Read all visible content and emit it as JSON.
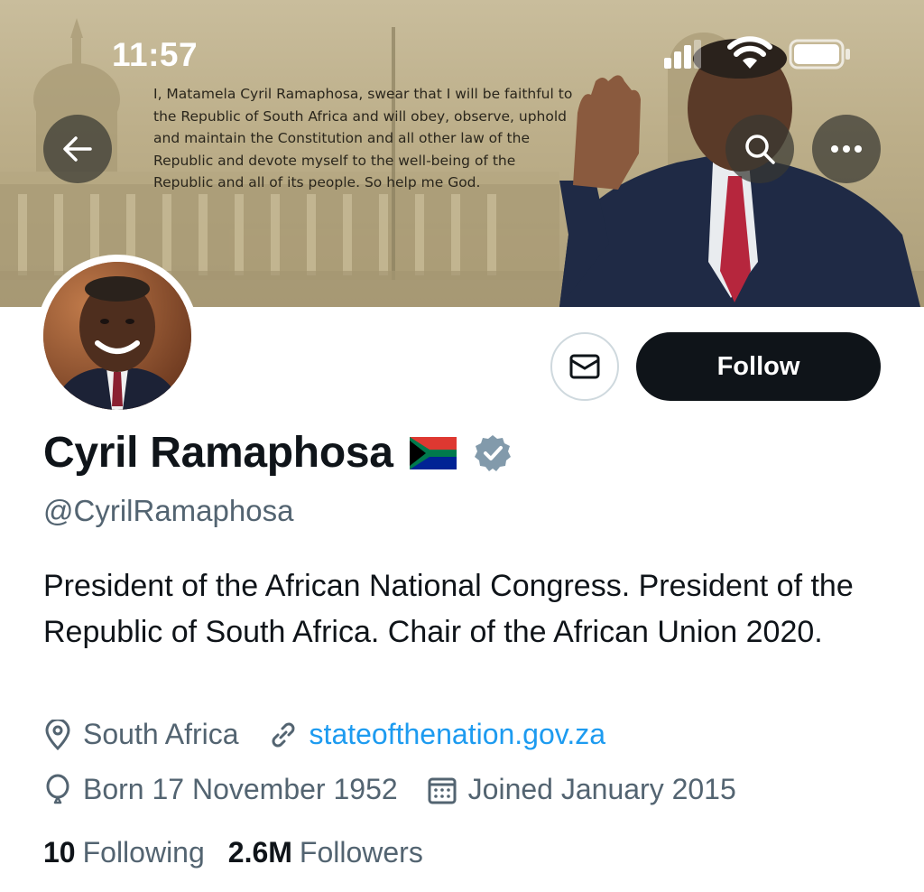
{
  "status_bar": {
    "time": "11:57"
  },
  "banner": {
    "oath_lines": [
      "I, Matamela Cyril Ramaphosa, swear that I will be faithful to",
      "the Republic of South Africa and will obey, observe, uphold",
      "and maintain the Constitution and all other law of the",
      "Republic and devote myself to the well-being of the",
      "Republic and all of its people. So help me God."
    ]
  },
  "toolbar": {
    "back_icon": "arrow-left-icon",
    "search_icon": "search-icon",
    "more_icon": "more-icon"
  },
  "actions": {
    "message_icon": "envelope-icon",
    "follow_label": "Follow"
  },
  "profile": {
    "name": "Cyril Ramaphosa",
    "handle": "@CyrilRamaphosa",
    "bio": "President of the African National Congress. President of the Republic of South Africa. Chair of the African Union 2020.",
    "location": "South Africa",
    "website": "stateofthenation.gov.za",
    "born": "Born 17 November 1952",
    "joined": "Joined January 2015"
  },
  "stats": {
    "following_count": "10",
    "following_label": "Following",
    "followers_count": "2.6M",
    "followers_label": "Followers"
  },
  "colors": {
    "link": "#1d9bf0",
    "secondary_text": "#536471",
    "follow_bg": "#0f1419",
    "verified": "#829aab"
  }
}
